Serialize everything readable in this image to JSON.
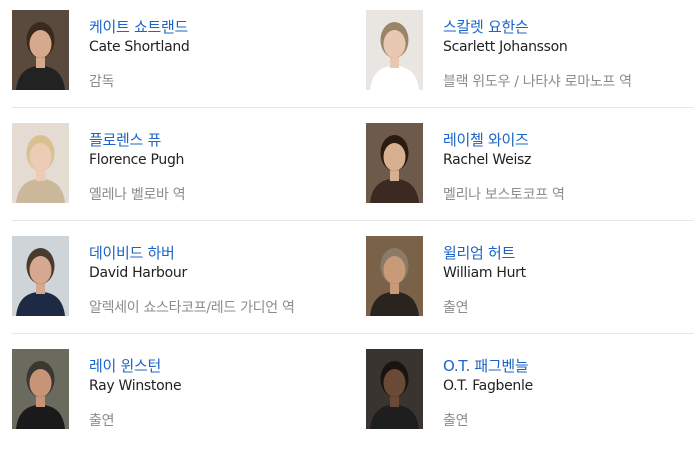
{
  "cast": [
    {
      "name_ko": "케이트 쇼트랜드",
      "name_en": "Cate Shortland",
      "role": "감독",
      "photo_bg": "#5a4a3e",
      "photo_skin": "#d6a88c",
      "photo_hair": "#3a2a1e",
      "photo_cloth": "#222222"
    },
    {
      "name_ko": "스칼렛 요한슨",
      "name_en": "Scarlett Johansson",
      "role": "블랙 위도우 / 나타샤 로마노프 역",
      "photo_bg": "#e9e6e2",
      "photo_skin": "#e8c8b0",
      "photo_hair": "#9a8468",
      "photo_cloth": "#ffffff"
    },
    {
      "name_ko": "플로렌스 퓨",
      "name_en": "Florence Pugh",
      "role": "옐레나 벨로바 역",
      "photo_bg": "#e4dcd2",
      "photo_skin": "#ecccb4",
      "photo_hair": "#d8c090",
      "photo_cloth": "#cbb89a"
    },
    {
      "name_ko": "레이첼 와이즈",
      "name_en": "Rachel Weisz",
      "role": "멜리나 보스토코프 역",
      "photo_bg": "#6e5a4a",
      "photo_skin": "#d8b090",
      "photo_hair": "#2a1a12",
      "photo_cloth": "#3a2a22"
    },
    {
      "name_ko": "데이비드 하버",
      "name_en": "David Harbour",
      "role": "알렉세이 쇼스타코프/레드 가디언 역",
      "photo_bg": "#cfd4d8",
      "photo_skin": "#d6a890",
      "photo_hair": "#4a3a2e",
      "photo_cloth": "#1e2a44"
    },
    {
      "name_ko": "윌리엄 허트",
      "name_en": "William Hurt",
      "role": "출연",
      "photo_bg": "#7a6248",
      "photo_skin": "#c89a78",
      "photo_hair": "#8a7a6a",
      "photo_cloth": "#2a2420"
    },
    {
      "name_ko": "레이 윈스턴",
      "name_en": "Ray Winstone",
      "role": "출연",
      "photo_bg": "#6a6a5e",
      "photo_skin": "#c89478",
      "photo_hair": "#3a3630",
      "photo_cloth": "#1a1a1a"
    },
    {
      "name_ko": "O.T. 패그벤늘",
      "name_en": "O.T. Fagbenle",
      "role": "출연",
      "photo_bg": "#3a3430",
      "photo_skin": "#6a4a36",
      "photo_hair": "#1a1410",
      "photo_cloth": "#1e1e1e"
    }
  ]
}
